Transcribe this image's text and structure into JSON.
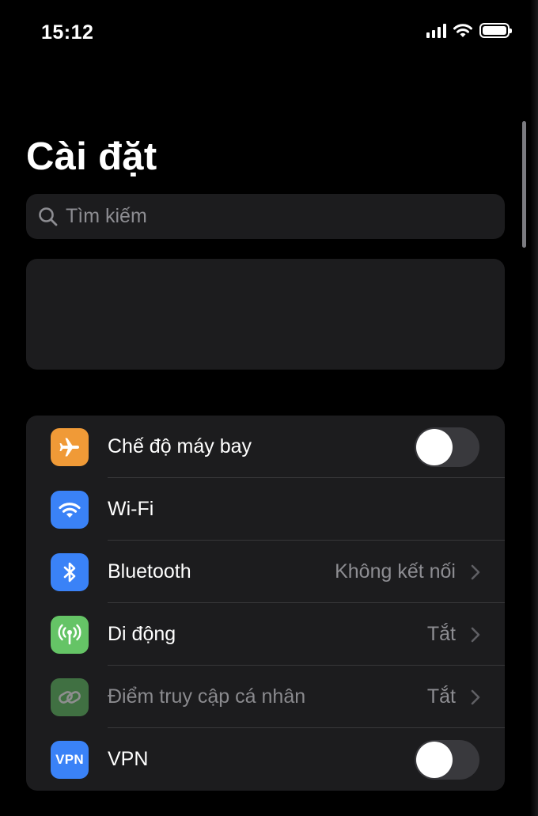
{
  "status_bar": {
    "time": "15:12",
    "icons": [
      "cellular-signal-icon",
      "wifi-icon",
      "battery-icon"
    ]
  },
  "page": {
    "title": "Cài đặt"
  },
  "search": {
    "placeholder": "Tìm kiếm",
    "icon": "search-icon"
  },
  "settings": [
    {
      "label": "Chế độ máy bay",
      "icon": "airplane-icon",
      "icon_color": "#f09a37",
      "control": "toggle",
      "on": false
    },
    {
      "label": "Wi-Fi",
      "icon": "wifi-icon",
      "icon_color": "#3a82f7",
      "control": "none"
    },
    {
      "label": "Bluetooth",
      "icon": "bluetooth-icon",
      "icon_color": "#3a82f7",
      "value": "Không kết nối",
      "control": "chevron"
    },
    {
      "label": "Di động",
      "icon": "cellular-antenna-icon",
      "icon_color": "#65c466",
      "value": "Tắt",
      "control": "chevron"
    },
    {
      "label": "Điểm truy cập cá nhân",
      "icon": "personal-hotspot-icon",
      "icon_color": "#65c466",
      "value": "Tắt",
      "control": "chevron",
      "dimmed": true
    },
    {
      "label": "VPN",
      "icon": "vpn-icon",
      "icon_text": "VPN",
      "icon_color": "#3a82f7",
      "control": "toggle",
      "on": false
    }
  ],
  "colors": {
    "background": "#000000",
    "card": "#1c1c1e",
    "secondary_text": "#8d8d92",
    "toggle_off": "#39393d"
  }
}
